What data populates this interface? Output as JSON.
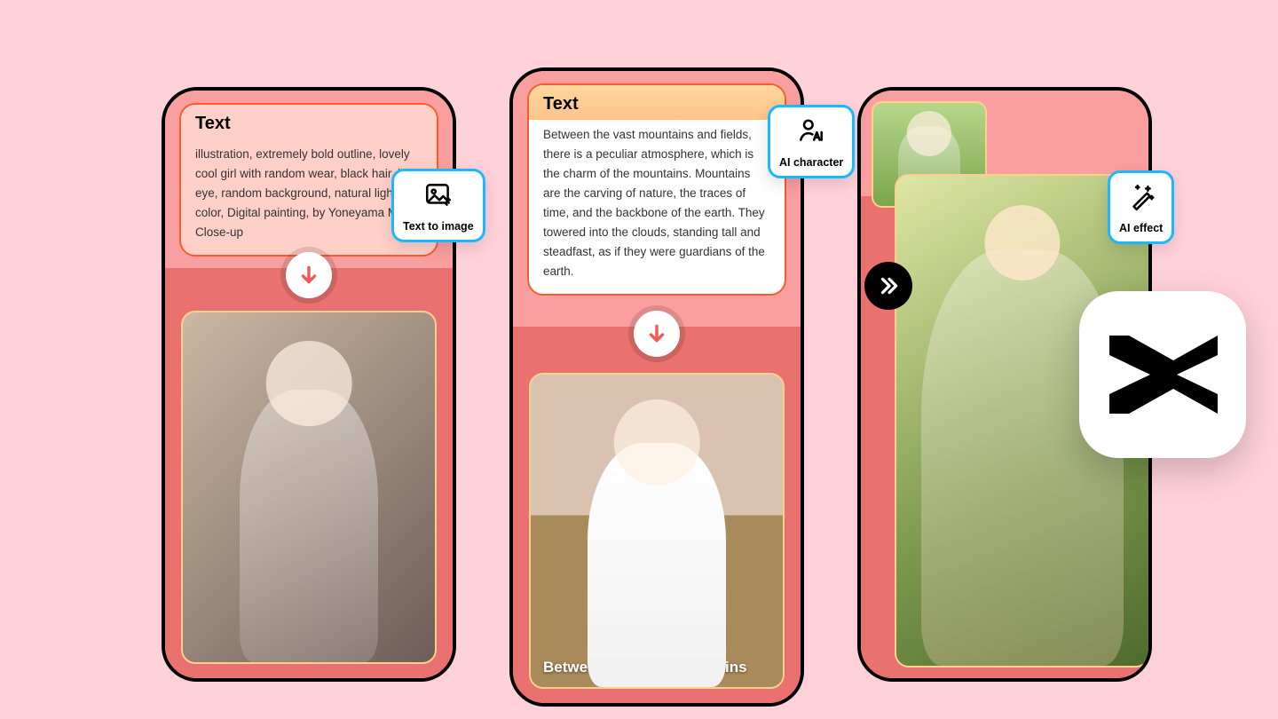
{
  "phone1": {
    "text_label": "Text",
    "prompt": "illustration, extremely bold outline, lovely cool girl with random wear, black hair, blue eye, random background, natural light color, Digital painting,  by Yoneyama Mai, Close-up"
  },
  "phone2": {
    "text_label": "Text",
    "prompt": "Between the vast mountains and fields, there is a peculiar atmosphere, which is the charm of the mountains. Mountains are the carving of nature, the traces of time, and the backbone of the earth. They towered into the clouds, standing tall and steadfast, as if they were guardians of the earth.",
    "caption": "Between the vast mountains"
  },
  "badges": {
    "t2i": "Text to image",
    "char": "AI character",
    "fx": "AI effect"
  },
  "app": {
    "name": "CapCut"
  }
}
